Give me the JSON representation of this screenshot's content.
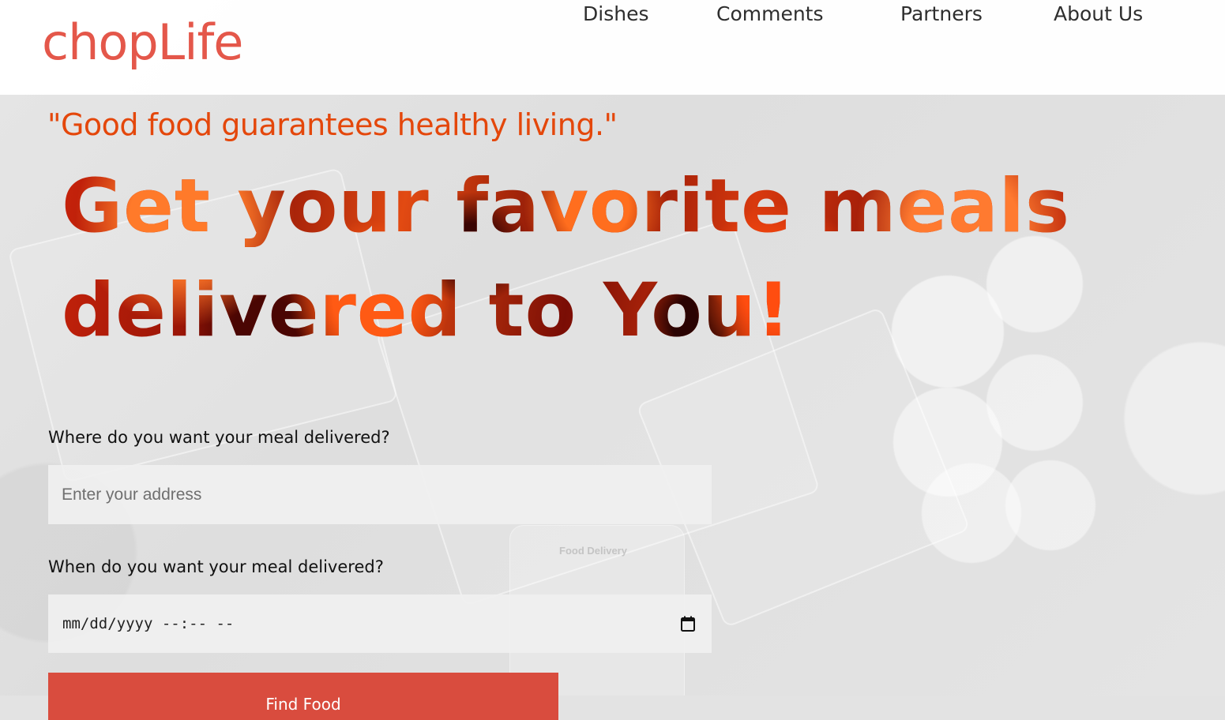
{
  "header": {
    "logo": "chopLife",
    "nav": [
      {
        "label": "Dishes"
      },
      {
        "label": "Comments"
      },
      {
        "label": "Partners"
      },
      {
        "label": "About Us"
      }
    ]
  },
  "hero": {
    "tagline": "\"Good food guarantees healthy living.\"",
    "headline_line1": "Get your favorite meals",
    "headline_line2": "delivered to You!"
  },
  "form": {
    "address_label": "Where do you want your meal delivered?",
    "address_placeholder": "Enter your address",
    "address_value": "",
    "datetime_label": "When do you want your meal delivered?",
    "datetime_display": "mm/dd/yyyy --:-- --",
    "submit_label": "Find Food"
  },
  "background": {
    "phone_label": "Food Delivery"
  },
  "colors": {
    "brand": "#e4574a",
    "tagline": "#e4470b",
    "button": "#d94c3e",
    "nav_text": "#2e2e2e"
  },
  "icons": {
    "calendar": "calendar-icon"
  }
}
